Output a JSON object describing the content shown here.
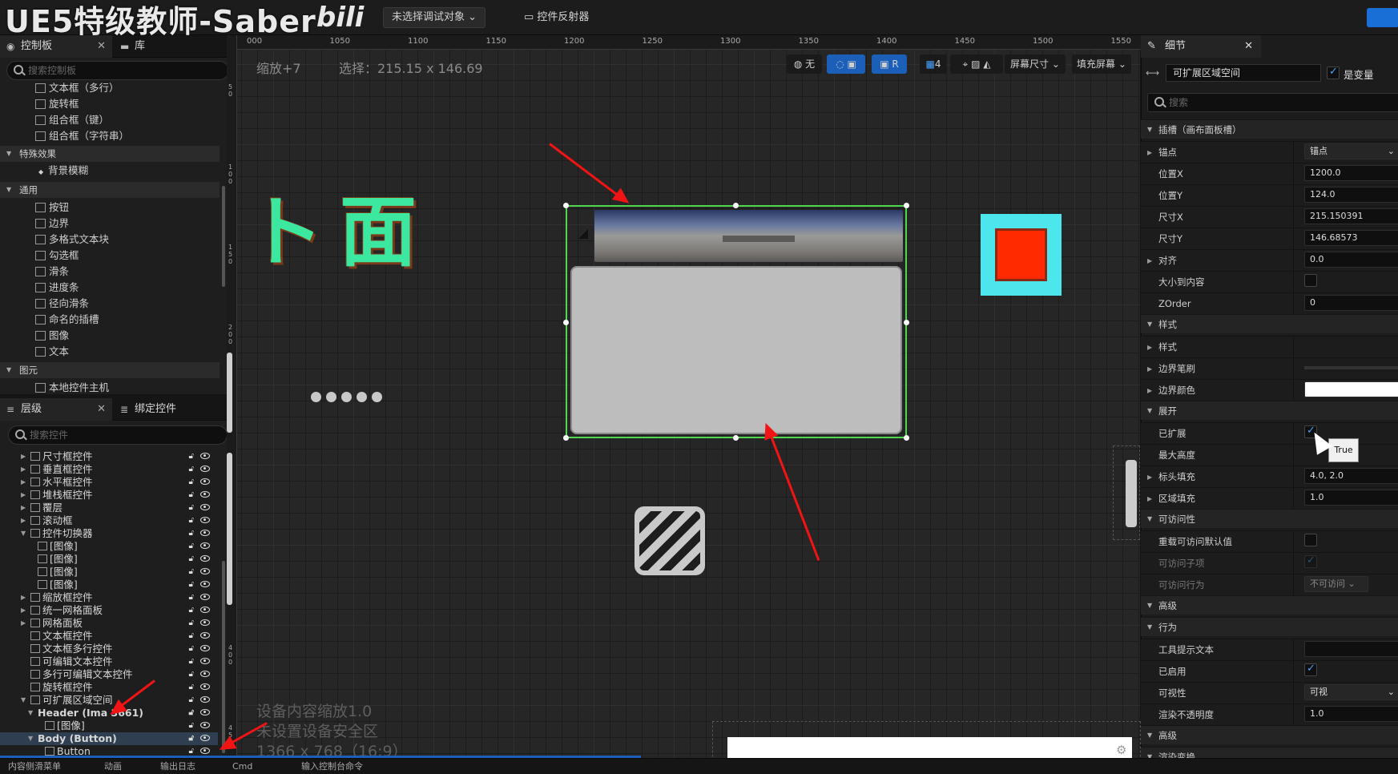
{
  "watermark": {
    "text": "UE5特级教师-Saber",
    "logo": "bilibili"
  },
  "toolbar": {
    "debug_dropdown": "未选择调试对象",
    "reflector": "控件反射器"
  },
  "palette": {
    "tab_label": "控制板",
    "library_tab": "库",
    "search_placeholder": "搜索控制板",
    "rows_top": [
      "文本框（多行）",
      "旋转框",
      "组合框（键）",
      "组合框（字符串）"
    ],
    "cat_special": "特殊效果",
    "special_items": [
      "背景模糊"
    ],
    "cat_common": "通用",
    "common_items": [
      "按钮",
      "边界",
      "多格式文本块",
      "勾选框",
      "滑条",
      "进度条",
      "径向滑条",
      "命名的插槽",
      "图像",
      "文本"
    ],
    "cat_primitive": "图元",
    "primitive_items": [
      "本地控件主机"
    ]
  },
  "hierarchy": {
    "tab_label": "层级",
    "bind_tab": "绑定控件",
    "search_placeholder": "搜索控件",
    "rows": [
      {
        "label": "尺寸框控件",
        "indent": 2,
        "arrow": "▶"
      },
      {
        "label": "垂直框控件",
        "indent": 2,
        "arrow": "▶"
      },
      {
        "label": "水平框控件",
        "indent": 2,
        "arrow": "▶"
      },
      {
        "label": "堆栈框控件",
        "indent": 2,
        "arrow": "▶"
      },
      {
        "label": "覆层",
        "indent": 2,
        "arrow": "▶"
      },
      {
        "label": "滚动框",
        "indent": 2,
        "arrow": "▶"
      },
      {
        "label": "控件切换器",
        "indent": 2,
        "arrow": "▼"
      },
      {
        "label": "[图像]",
        "indent": 3,
        "arrow": ""
      },
      {
        "label": "[图像]",
        "indent": 3,
        "arrow": ""
      },
      {
        "label": "[图像]",
        "indent": 3,
        "arrow": ""
      },
      {
        "label": "[图像]",
        "indent": 3,
        "arrow": ""
      },
      {
        "label": "缩放框控件",
        "indent": 2,
        "arrow": "▶"
      },
      {
        "label": "统一网格面板",
        "indent": 2,
        "arrow": "▶"
      },
      {
        "label": "网格面板",
        "indent": 2,
        "arrow": "▶"
      },
      {
        "label": "文本框控件",
        "indent": 2,
        "arrow": ""
      },
      {
        "label": "文本框多行控件",
        "indent": 2,
        "arrow": ""
      },
      {
        "label": "可编辑文本控件",
        "indent": 2,
        "arrow": ""
      },
      {
        "label": "多行可编辑文本控件",
        "indent": 2,
        "arrow": ""
      },
      {
        "label": "旋转框控件",
        "indent": 2,
        "arrow": ""
      },
      {
        "label": "可扩展区域空间",
        "indent": 2,
        "arrow": "▼"
      },
      {
        "label": "Header (Image_3661)",
        "indent": 3,
        "arrow": "▼"
      },
      {
        "label": "[图像]",
        "indent": 4,
        "arrow": ""
      },
      {
        "label": "Body (Button)",
        "indent": 3,
        "arrow": "▼"
      },
      {
        "label": "Button",
        "indent": 4,
        "arrow": ""
      }
    ],
    "header_display": "Header (Ima   3661)"
  },
  "viewport": {
    "zoom": "缩放+7",
    "selection": "选择：215.15 x 146.69",
    "ruler_top": [
      "000",
      "1050",
      "1100",
      "1150",
      "1200",
      "1250",
      "1300",
      "1350",
      "1400",
      "1450",
      "1500",
      "1550"
    ],
    "ruler_left": [
      "50",
      "100",
      "150",
      "200",
      "250",
      "300",
      "350",
      "400",
      "450"
    ],
    "tools": {
      "none": "无",
      "r": "R",
      "grid": "4",
      "screen_size": "屏幕尺寸",
      "fill": "填充屏幕"
    },
    "canvas_text": "界面",
    "canvas_text_display": "ト面",
    "dpi_scale": "设备内容缩放1.0",
    "safe_zone": "未设置设备安全区",
    "resolution": "1366 x 768（16:9）"
  },
  "details": {
    "tab_label": "细节",
    "widget_name": "可扩展区域空间",
    "is_variable": "是变量",
    "search_placeholder": "搜索",
    "rows": [
      {
        "type": "cat",
        "label": "插槽（画布面板槽）"
      },
      {
        "type": "row",
        "label": "锚点",
        "value": "锚点",
        "exp": true,
        "kind": "dropdown"
      },
      {
        "type": "row",
        "label": "位置X",
        "value": "1200.0"
      },
      {
        "type": "row",
        "label": "位置Y",
        "value": "124.0"
      },
      {
        "type": "row",
        "label": "尺寸X",
        "value": "215.150391"
      },
      {
        "type": "row",
        "label": "尺寸Y",
        "value": "146.68573"
      },
      {
        "type": "row",
        "label": "对齐",
        "value": "0.0",
        "exp": true
      },
      {
        "type": "row",
        "label": "大小到内容",
        "kind": "check"
      },
      {
        "type": "row",
        "label": "ZOrder",
        "value": "0"
      },
      {
        "type": "cat",
        "label": "样式"
      },
      {
        "type": "row",
        "label": "样式",
        "exp": true
      },
      {
        "type": "row",
        "label": "边界笔刷",
        "exp": true
      },
      {
        "type": "row",
        "label": "边界颜色",
        "exp": true,
        "kind": "color"
      },
      {
        "type": "cat",
        "label": "展开"
      },
      {
        "type": "row",
        "label": "已扩展",
        "kind": "check-on"
      },
      {
        "type": "row",
        "label": "最大高度"
      },
      {
        "type": "row",
        "label": "标头填充",
        "value": "4.0, 2.0",
        "exp": true
      },
      {
        "type": "row",
        "label": "区域填充",
        "value": "1.0",
        "exp": true
      },
      {
        "type": "cat",
        "label": "可访问性"
      },
      {
        "type": "row",
        "label": "重载可访问默认值",
        "kind": "check"
      },
      {
        "type": "row",
        "label": "可访问子项",
        "kind": "check-dim",
        "dim": true
      },
      {
        "type": "row",
        "label": "可访问行为",
        "value": "不可访问",
        "dim": true,
        "kind": "dropdown-small"
      },
      {
        "type": "catc",
        "label": "高级"
      },
      {
        "type": "cat",
        "label": "行为"
      },
      {
        "type": "row",
        "label": "工具提示文本",
        "kind": "text"
      },
      {
        "type": "row",
        "label": "已启用",
        "kind": "check-on"
      },
      {
        "type": "row",
        "label": "可视性",
        "value": "可视",
        "kind": "dropdown"
      },
      {
        "type": "row",
        "label": "渲染不透明度",
        "value": "1.0"
      },
      {
        "type": "catc",
        "label": "高级"
      },
      {
        "type": "cat",
        "label": "渲染变换"
      }
    ],
    "tooltip": "True"
  },
  "bottom": {
    "items": [
      "内容侧滑菜单",
      "动画",
      "输出日志",
      "Cmd",
      "输入控制台命令"
    ]
  },
  "colors": {
    "widget_outline": "#4fd84f",
    "accent": "#1c5fb8",
    "arrow": "#f01414",
    "canvas_text": "#3ce8a0"
  }
}
